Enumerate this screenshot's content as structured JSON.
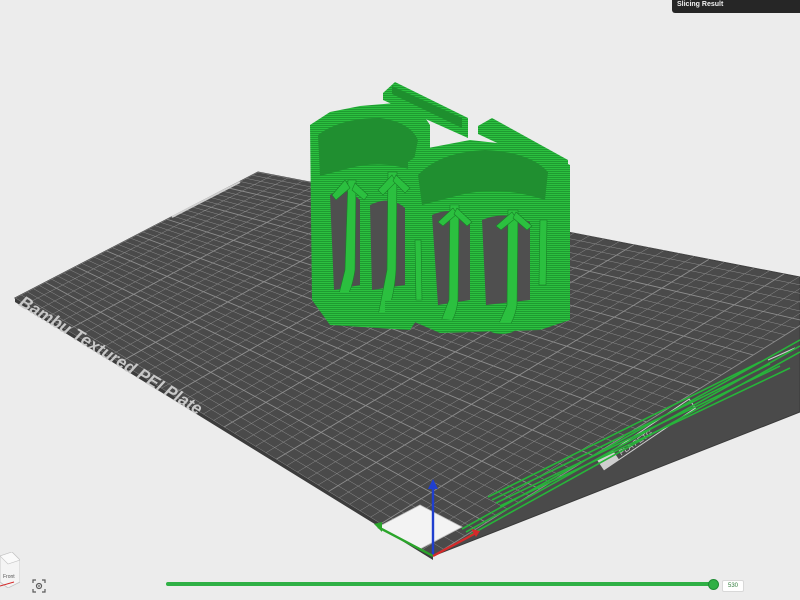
{
  "panel": {
    "title": "Slicing Result"
  },
  "plate": {
    "name": "Bambu Textured PEI Plate",
    "corner_label": "PLA PETG"
  },
  "view_cube": {
    "face_label": "Front"
  },
  "layer_slider": {
    "value": "530",
    "position": 0.99
  },
  "colors": {
    "model": "#27b43a",
    "model_dark": "#1d8a2b",
    "plate": "#4a4a4a",
    "grid": "#8e8e8e",
    "background": "#ececec",
    "axis_x": "#d42a2a",
    "axis_y": "#2aa52a",
    "axis_z": "#1f3fcf"
  },
  "icons": {
    "camera": "camera-focus-icon",
    "cube": "view-cube-icon"
  }
}
